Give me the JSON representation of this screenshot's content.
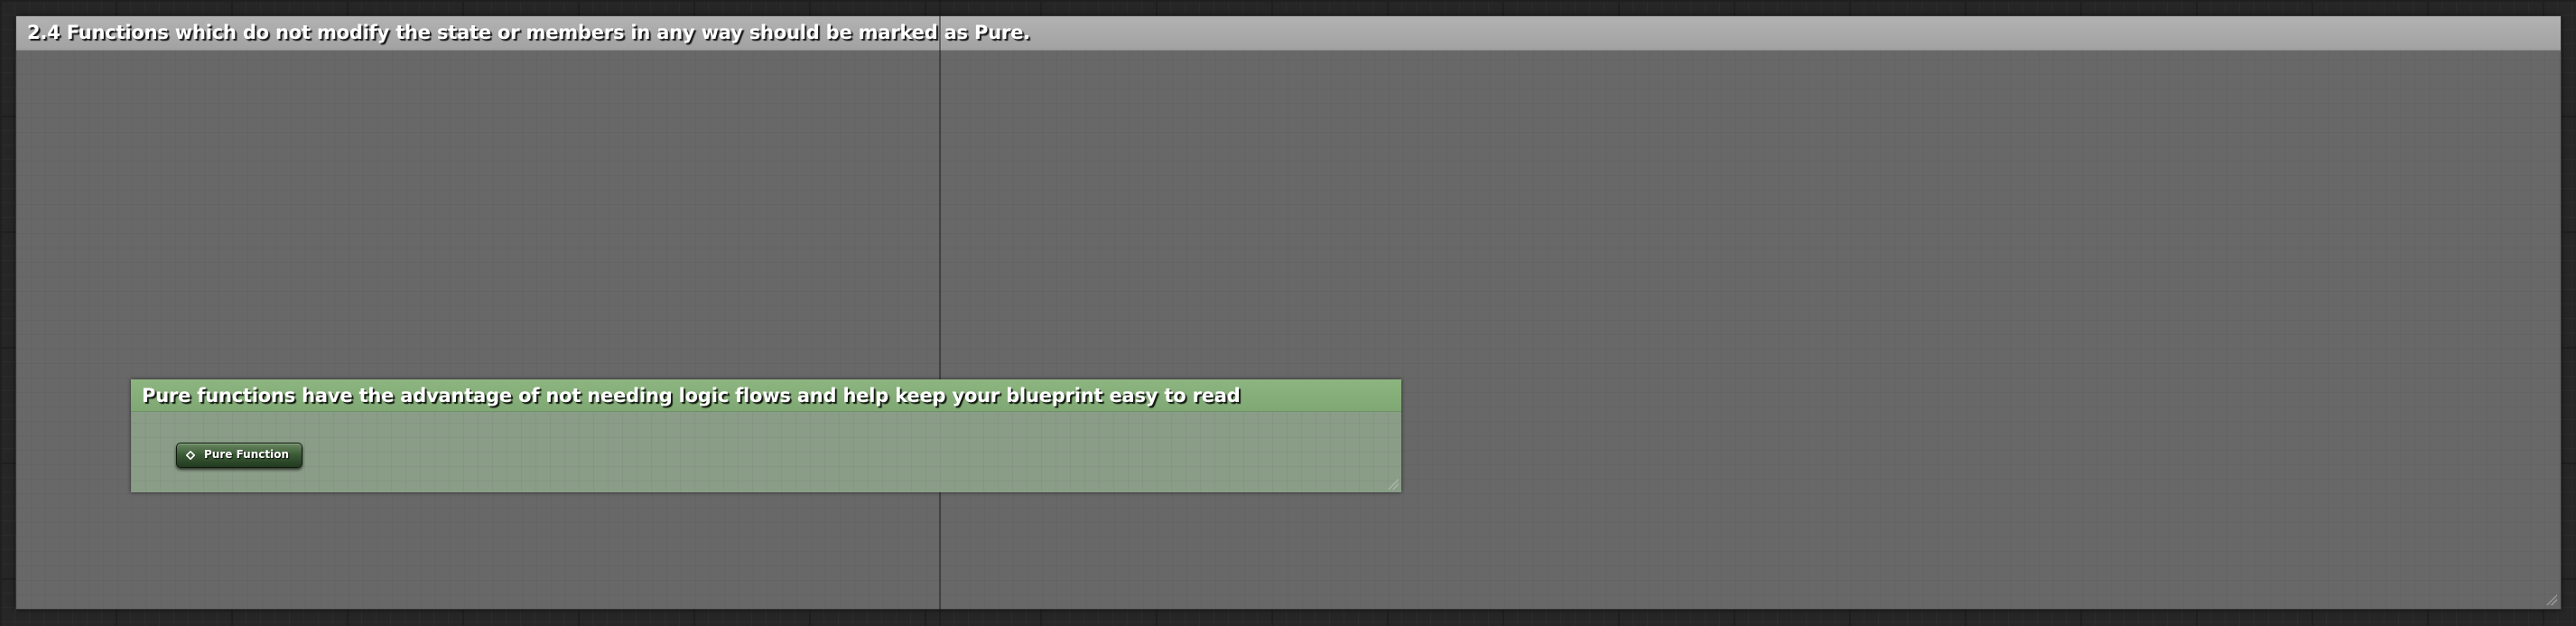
{
  "outer_comment": {
    "title": "2.4 Functions which do not modify the state or members in any way should be marked as Pure.",
    "header_color": "#aaaaaa",
    "body_color": "#686868"
  },
  "inner_comment": {
    "title": "Pure functions have the advantage of not needing logic flows and help keep your blueprint easy to read",
    "header_color": "#85ad79",
    "body_color": "#8a9d87"
  },
  "pure_node": {
    "label": "Pure Function",
    "icon": "function-diamond-icon",
    "color": "#3d5c38"
  }
}
